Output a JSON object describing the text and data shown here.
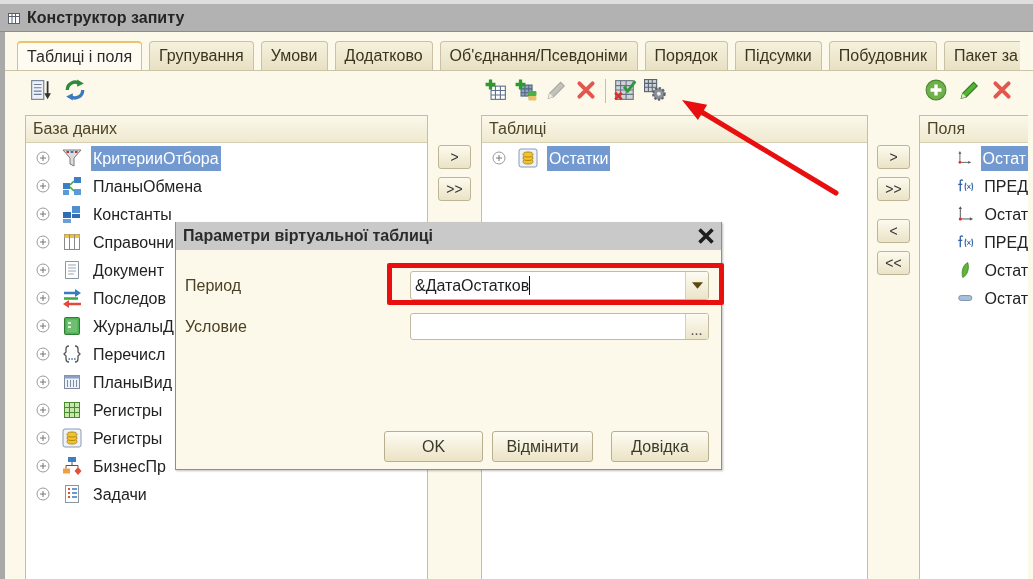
{
  "window": {
    "title": "Конструктор запиту"
  },
  "tabs": [
    {
      "label": "Таблиці і поля",
      "selected": true
    },
    {
      "label": "Групування",
      "selected": false
    },
    {
      "label": "Умови",
      "selected": false
    },
    {
      "label": "Додатково",
      "selected": false
    },
    {
      "label": "Об'єднання/Псевдоніми",
      "selected": false
    },
    {
      "label": "Порядок",
      "selected": false
    },
    {
      "label": "Підсумки",
      "selected": false
    },
    {
      "label": "Побудовник",
      "selected": false
    },
    {
      "label": "Пакет за",
      "selected": false
    }
  ],
  "database_panel": {
    "toolbar": [
      [
        {
          "kind": "sort",
          "disabled": false
        },
        {
          "kind": "refresh",
          "disabled": false
        }
      ]
    ],
    "header": "База даних",
    "items": [
      {
        "label": "КритерииОтбора",
        "kind": "filter",
        "expanded": false,
        "selected": true
      },
      {
        "label": "ПланыОбмена",
        "kind": "exchange",
        "expanded": false,
        "selected": false
      },
      {
        "label": "Константы",
        "kind": "constants",
        "expanded": false,
        "selected": false
      },
      {
        "label": "Справочни",
        "kind": "catalogs",
        "expanded": false,
        "selected": false
      },
      {
        "label": "Документ",
        "kind": "documents",
        "expanded": false,
        "selected": false
      },
      {
        "label": "Последов",
        "kind": "sequences",
        "expanded": false,
        "selected": false
      },
      {
        "label": "ЖурналыД",
        "kind": "journals",
        "expanded": false,
        "selected": false
      },
      {
        "label": "Перечисл",
        "kind": "enums",
        "expanded": false,
        "selected": false
      },
      {
        "label": "ПланыВид",
        "kind": "charts",
        "expanded": false,
        "selected": false
      },
      {
        "label": "Регистры",
        "kind": "inforegs",
        "expanded": false,
        "selected": false
      },
      {
        "label": "Регистры",
        "kind": "accregs",
        "expanded": false,
        "selected": false
      },
      {
        "label": "БизнесПр",
        "kind": "processes",
        "expanded": false,
        "selected": false
      },
      {
        "label": "Задачи",
        "kind": "tasks",
        "expanded": false,
        "selected": false
      }
    ]
  },
  "left_transfer_buttons": [
    ">",
    ">>"
  ],
  "tables_panel": {
    "toolbar": [
      [
        {
          "kind": "add",
          "disabled": false
        },
        {
          "kind": "addnested",
          "disabled": false
        },
        {
          "kind": "edit",
          "disabled": true
        },
        {
          "kind": "delete",
          "disabled": false
        }
      ],
      [
        {
          "kind": "check",
          "disabled": false
        },
        {
          "kind": "params",
          "disabled": false
        }
      ]
    ],
    "header": "Таблиці",
    "items": [
      {
        "label": "Остатки",
        "kind": "accregs",
        "expanded": false,
        "selected": true
      }
    ]
  },
  "right_transfer_buttons": [
    ">",
    ">>",
    "<",
    "<<"
  ],
  "fields_panel": {
    "toolbar": [
      [
        {
          "kind": "addcircle",
          "disabled": false
        },
        {
          "kind": "edit",
          "disabled": false
        },
        {
          "kind": "delete",
          "disabled": false
        }
      ]
    ],
    "header": "Поля",
    "items": [
      {
        "label": "Остат",
        "kind": "dimension",
        "selected": true
      },
      {
        "label": "ПРЕД",
        "kind": "function",
        "selected": false
      },
      {
        "label": "Остат",
        "kind": "dimension",
        "selected": false
      },
      {
        "label": "ПРЕД",
        "kind": "function",
        "selected": false
      },
      {
        "label": "Остат",
        "kind": "resource",
        "selected": false
      },
      {
        "label": "Остат",
        "kind": "attribute",
        "selected": false
      }
    ]
  },
  "dialog": {
    "title": "Параметри віртуальної таблиці",
    "fields": [
      {
        "label": "Период",
        "kind": "dropdown",
        "value": "&ДатаОстатков",
        "focused": true
      },
      {
        "label": "Условие",
        "kind": "choice",
        "button": "...",
        "focused": false
      }
    ],
    "buttons": [
      "OK",
      "Відмінити",
      "Довідка"
    ]
  }
}
